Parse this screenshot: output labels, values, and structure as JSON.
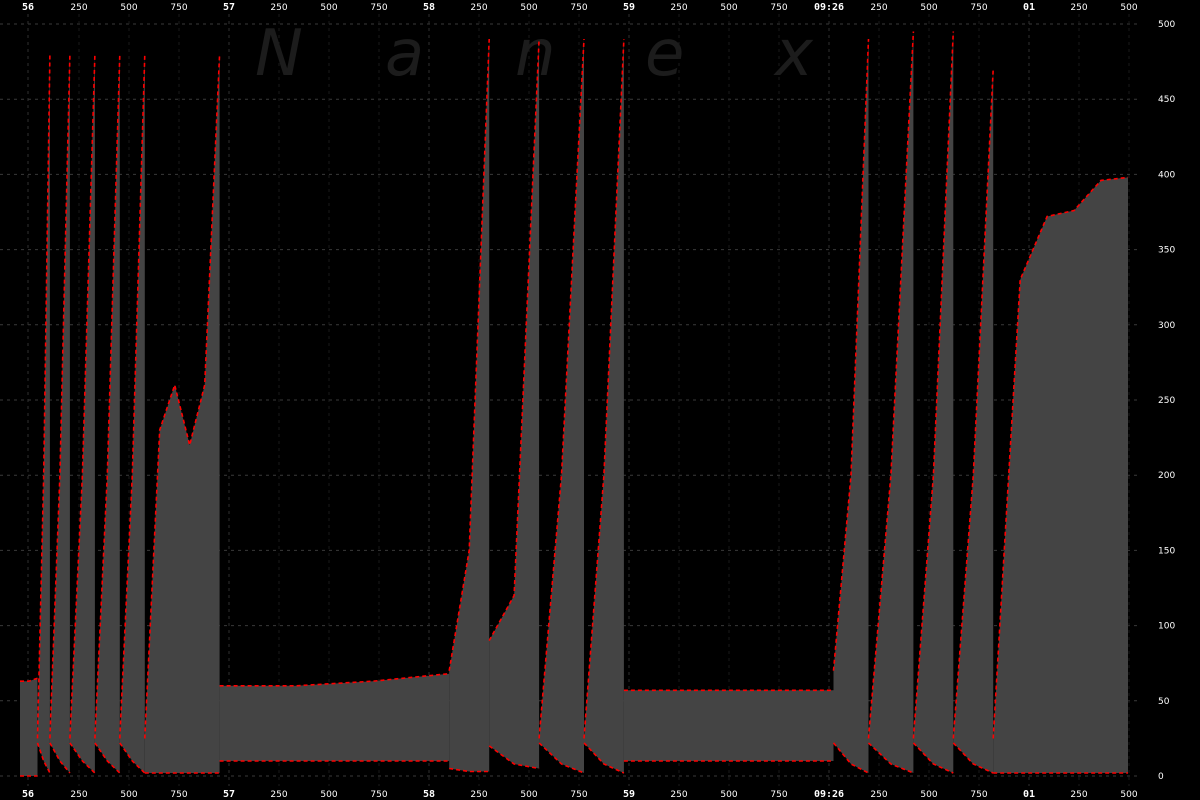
{
  "chart_data": {
    "type": "area",
    "watermark": [
      "N",
      "a",
      "n",
      "e",
      "x"
    ],
    "ylim": [
      0,
      500
    ],
    "y_ticks": [
      0,
      50,
      100,
      150,
      200,
      250,
      300,
      350,
      400,
      450,
      500
    ],
    "grid": true,
    "x_ticks_top": [
      "56",
      "250",
      "500",
      "750",
      "57",
      "250",
      "500",
      "750",
      "58",
      "250",
      "500",
      "750",
      "59",
      "250",
      "500",
      "750",
      "09:26",
      "250",
      "500",
      "750",
      "01",
      "250",
      "500"
    ],
    "x_ticks_bottom": [
      "56",
      "250",
      "500",
      "750",
      "57",
      "250",
      "500",
      "750",
      "58",
      "250",
      "500",
      "750",
      "59",
      "250",
      "500",
      "750",
      "09:26",
      "250",
      "500",
      "750",
      "01",
      "250",
      "500"
    ],
    "series": [
      {
        "fill_color": "#444444",
        "edge_color": "#ff0000",
        "segments": [
          {
            "x0": 0,
            "x1": 35,
            "bottom": [
              0,
              0,
              0
            ],
            "top": [
              63,
              63,
              65
            ]
          },
          {
            "x0": 35,
            "x1": 60,
            "bottom": [
              22,
              10,
              2
            ],
            "top": [
              25,
              200,
              480
            ]
          },
          {
            "x0": 60,
            "x1": 100,
            "bottom": [
              22,
              10,
              2
            ],
            "top": [
              25,
              200,
              480
            ]
          },
          {
            "x0": 100,
            "x1": 150,
            "bottom": [
              22,
              10,
              2
            ],
            "top": [
              25,
              200,
              480
            ]
          },
          {
            "x0": 150,
            "x1": 200,
            "bottom": [
              22,
              10,
              2
            ],
            "top": [
              25,
              200,
              480
            ]
          },
          {
            "x0": 200,
            "x1": 250,
            "bottom": [
              22,
              10,
              2
            ],
            "top": [
              25,
              200,
              480
            ]
          },
          {
            "x0": 250,
            "x1": 400,
            "bottom": [
              2,
              2,
              2
            ],
            "top": [
              25,
              230,
              260,
              220,
              260,
              480
            ]
          },
          {
            "x0": 400,
            "x1": 860,
            "bottom": [
              10,
              10,
              10,
              10
            ],
            "top": [
              60,
              60,
              63,
              68
            ]
          },
          {
            "x0": 860,
            "x1": 940,
            "bottom": [
              5,
              3,
              3
            ],
            "top": [
              70,
              150,
              490
            ]
          },
          {
            "x0": 940,
            "x1": 1040,
            "bottom": [
              20,
              8,
              5
            ],
            "top": [
              90,
              120,
              490
            ]
          },
          {
            "x0": 1040,
            "x1": 1130,
            "bottom": [
              22,
              8,
              2
            ],
            "top": [
              25,
              200,
              490
            ]
          },
          {
            "x0": 1130,
            "x1": 1210,
            "bottom": [
              22,
              8,
              2
            ],
            "top": [
              25,
              200,
              490
            ]
          },
          {
            "x0": 1210,
            "x1": 1630,
            "bottom": [
              10,
              10
            ],
            "top": [
              57,
              57
            ]
          },
          {
            "x0": 1630,
            "x1": 1700,
            "bottom": [
              22,
              8,
              2
            ],
            "top": [
              70,
              200,
              490
            ]
          },
          {
            "x0": 1700,
            "x1": 1790,
            "bottom": [
              22,
              8,
              2
            ],
            "top": [
              25,
              200,
              495
            ]
          },
          {
            "x0": 1790,
            "x1": 1870,
            "bottom": [
              22,
              8,
              2
            ],
            "top": [
              25,
              200,
              495
            ]
          },
          {
            "x0": 1870,
            "x1": 1950,
            "bottom": [
              22,
              8,
              2
            ],
            "top": [
              25,
              200,
              470
            ]
          },
          {
            "x0": 1950,
            "x1": 2220,
            "bottom": [
              2,
              2,
              2
            ],
            "top": [
              25,
              330,
              372,
              376,
              396,
              398
            ]
          }
        ]
      }
    ]
  }
}
